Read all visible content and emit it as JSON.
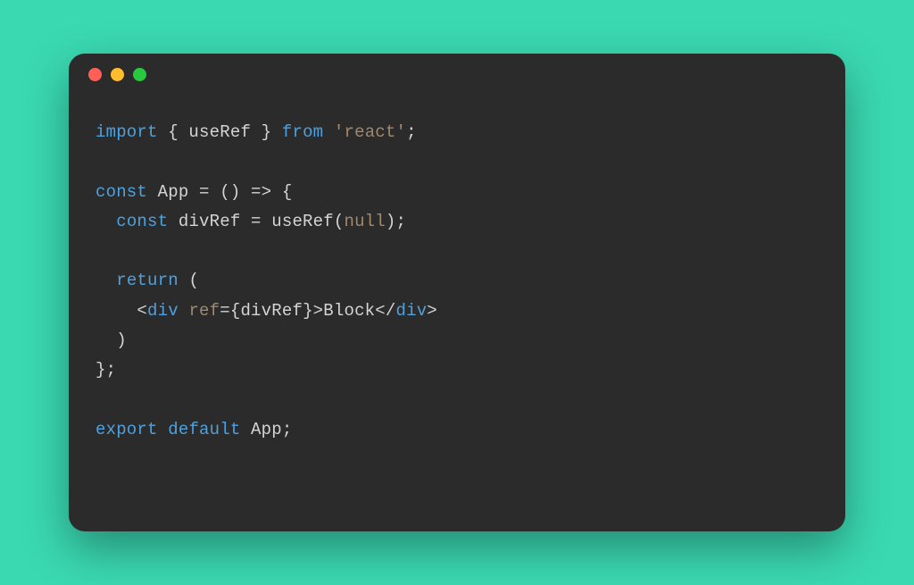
{
  "window": {
    "traffic_lights": [
      "close",
      "minimize",
      "maximize"
    ]
  },
  "code": {
    "tokens": [
      [
        {
          "t": "import",
          "c": "kw"
        },
        {
          "t": " { useRef } ",
          "c": "punct"
        },
        {
          "t": "from",
          "c": "kw"
        },
        {
          "t": " ",
          "c": "punct"
        },
        {
          "t": "'react'",
          "c": "str"
        },
        {
          "t": ";",
          "c": "punct"
        }
      ],
      [],
      [
        {
          "t": "const",
          "c": "kw"
        },
        {
          "t": " App = () => {",
          "c": "punct"
        }
      ],
      [
        {
          "t": "  ",
          "c": "punct"
        },
        {
          "t": "const",
          "c": "kw"
        },
        {
          "t": " divRef = useRef(",
          "c": "punct"
        },
        {
          "t": "null",
          "c": "null"
        },
        {
          "t": ");",
          "c": "punct"
        }
      ],
      [],
      [
        {
          "t": "  ",
          "c": "punct"
        },
        {
          "t": "return",
          "c": "kw"
        },
        {
          "t": " (",
          "c": "punct"
        }
      ],
      [
        {
          "t": "    <",
          "c": "punct"
        },
        {
          "t": "div",
          "c": "tag"
        },
        {
          "t": " ",
          "c": "punct"
        },
        {
          "t": "ref",
          "c": "attr"
        },
        {
          "t": "={divRef}>Block</",
          "c": "punct"
        },
        {
          "t": "div",
          "c": "tag"
        },
        {
          "t": ">",
          "c": "punct"
        }
      ],
      [
        {
          "t": "  )",
          "c": "punct"
        }
      ],
      [
        {
          "t": "};",
          "c": "punct"
        }
      ],
      [],
      [
        {
          "t": "export",
          "c": "kw"
        },
        {
          "t": " ",
          "c": "punct"
        },
        {
          "t": "default",
          "c": "kw"
        },
        {
          "t": " App;",
          "c": "punct"
        }
      ]
    ]
  }
}
